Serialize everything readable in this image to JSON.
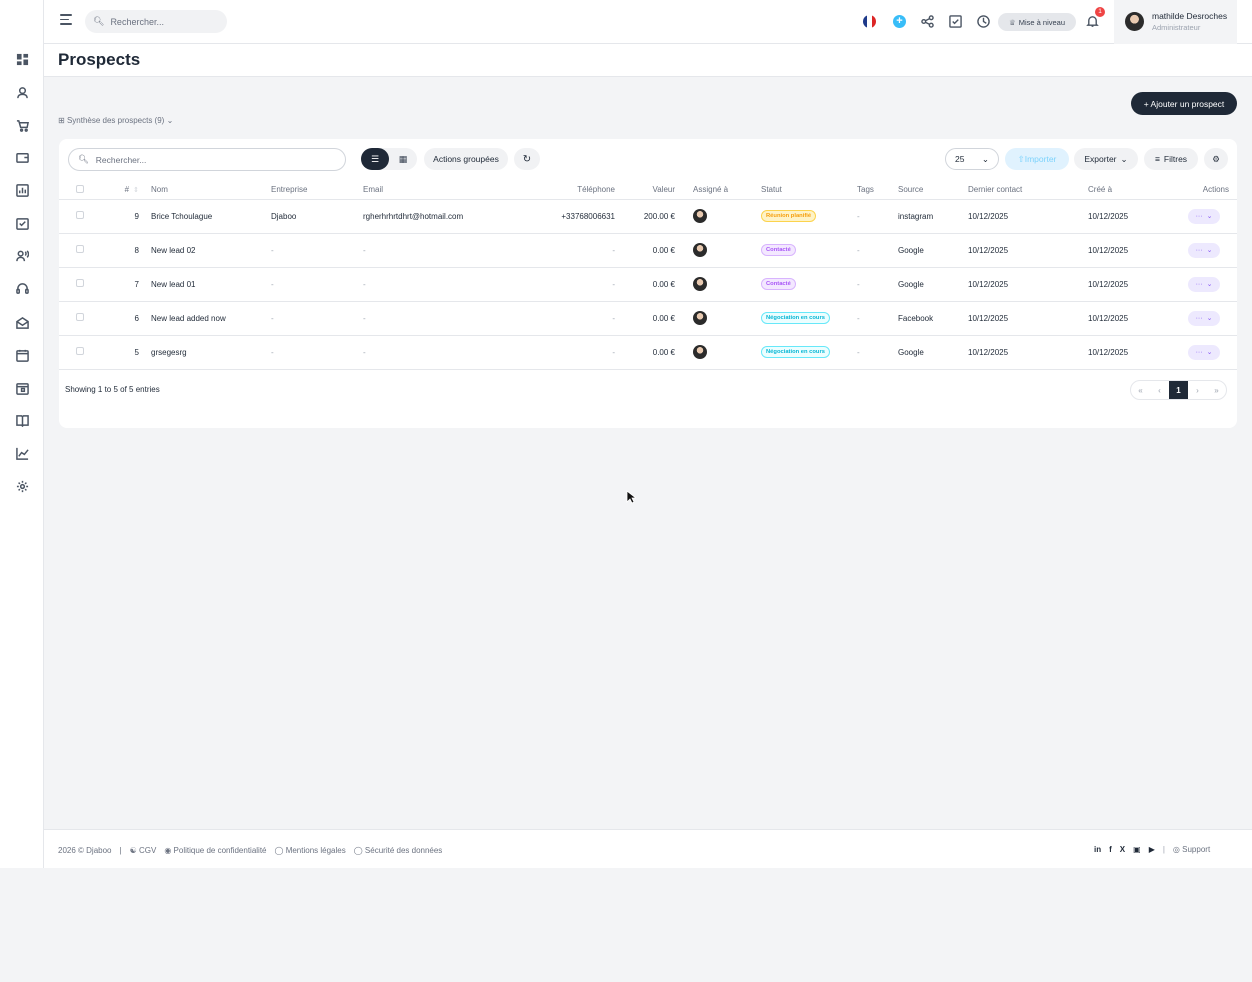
{
  "topbar": {
    "search_placeholder": "Rechercher...",
    "upgrade_label": "Mise à niveau",
    "notif_count": "1",
    "user_name": "mathilde Desroches",
    "user_role": "Administrateur"
  },
  "page": {
    "title": "Prospects",
    "add_button": "+ Ajouter un prospect",
    "summary_label": "Synthèse des prospects (9)"
  },
  "toolbar": {
    "search_placeholder": "Rechercher...",
    "bulk_actions": "Actions groupées",
    "per_page": "25",
    "import": "Importer",
    "export": "Exporter",
    "filters": "Filtres"
  },
  "table": {
    "headers": [
      "#",
      "Nom",
      "Entreprise",
      "Email",
      "Téléphone",
      "Valeur",
      "Assigné à",
      "Statut",
      "Tags",
      "Source",
      "Dernier contact",
      "Créé à",
      "Actions"
    ],
    "rows": [
      {
        "id": "9",
        "name": "Brice Tchoulague",
        "company": "Djaboo",
        "email": "rgherhrhrtdhrt@hotmail.com",
        "phone": "+33768006631",
        "value": "200.00 €",
        "status": "Réunion planifié",
        "status_color": "orange",
        "tags": "-",
        "source": "instagram",
        "last_contact": "10/12/2025",
        "created": "10/12/2025"
      },
      {
        "id": "8",
        "name": "New lead 02",
        "company": "-",
        "email": "-",
        "phone": "-",
        "value": "0.00 €",
        "status": "Contacté",
        "status_color": "purple",
        "tags": "-",
        "source": "Google",
        "last_contact": "10/12/2025",
        "created": "10/12/2025"
      },
      {
        "id": "7",
        "name": "New lead 01",
        "company": "-",
        "email": "-",
        "phone": "-",
        "value": "0.00 €",
        "status": "Contacté",
        "status_color": "purple",
        "tags": "-",
        "source": "Google",
        "last_contact": "10/12/2025",
        "created": "10/12/2025"
      },
      {
        "id": "6",
        "name": "New lead added now",
        "company": "-",
        "email": "-",
        "phone": "-",
        "value": "0.00 €",
        "status": "Négociation en cours",
        "status_color": "cyan",
        "tags": "-",
        "source": "Facebook",
        "last_contact": "10/12/2025",
        "created": "10/12/2025"
      },
      {
        "id": "5",
        "name": "grsegesrg",
        "company": "-",
        "email": "-",
        "phone": "-",
        "value": "0.00 €",
        "status": "Négociation en cours",
        "status_color": "cyan",
        "tags": "-",
        "source": "Google",
        "last_contact": "10/12/2025",
        "created": "10/12/2025"
      }
    ],
    "action_label": "···"
  },
  "pagination": {
    "showing": "Showing 1 to 5 of 5 entries",
    "first": "«",
    "prev": "‹",
    "current": "1",
    "next": "›",
    "last": "»"
  },
  "footer": {
    "copyright": "2026 © Djaboo",
    "cgv": "CGV",
    "privacy": "Politique de confidentialité",
    "legal": "Mentions légales",
    "security": "Sécurité des données",
    "support": "Support"
  }
}
